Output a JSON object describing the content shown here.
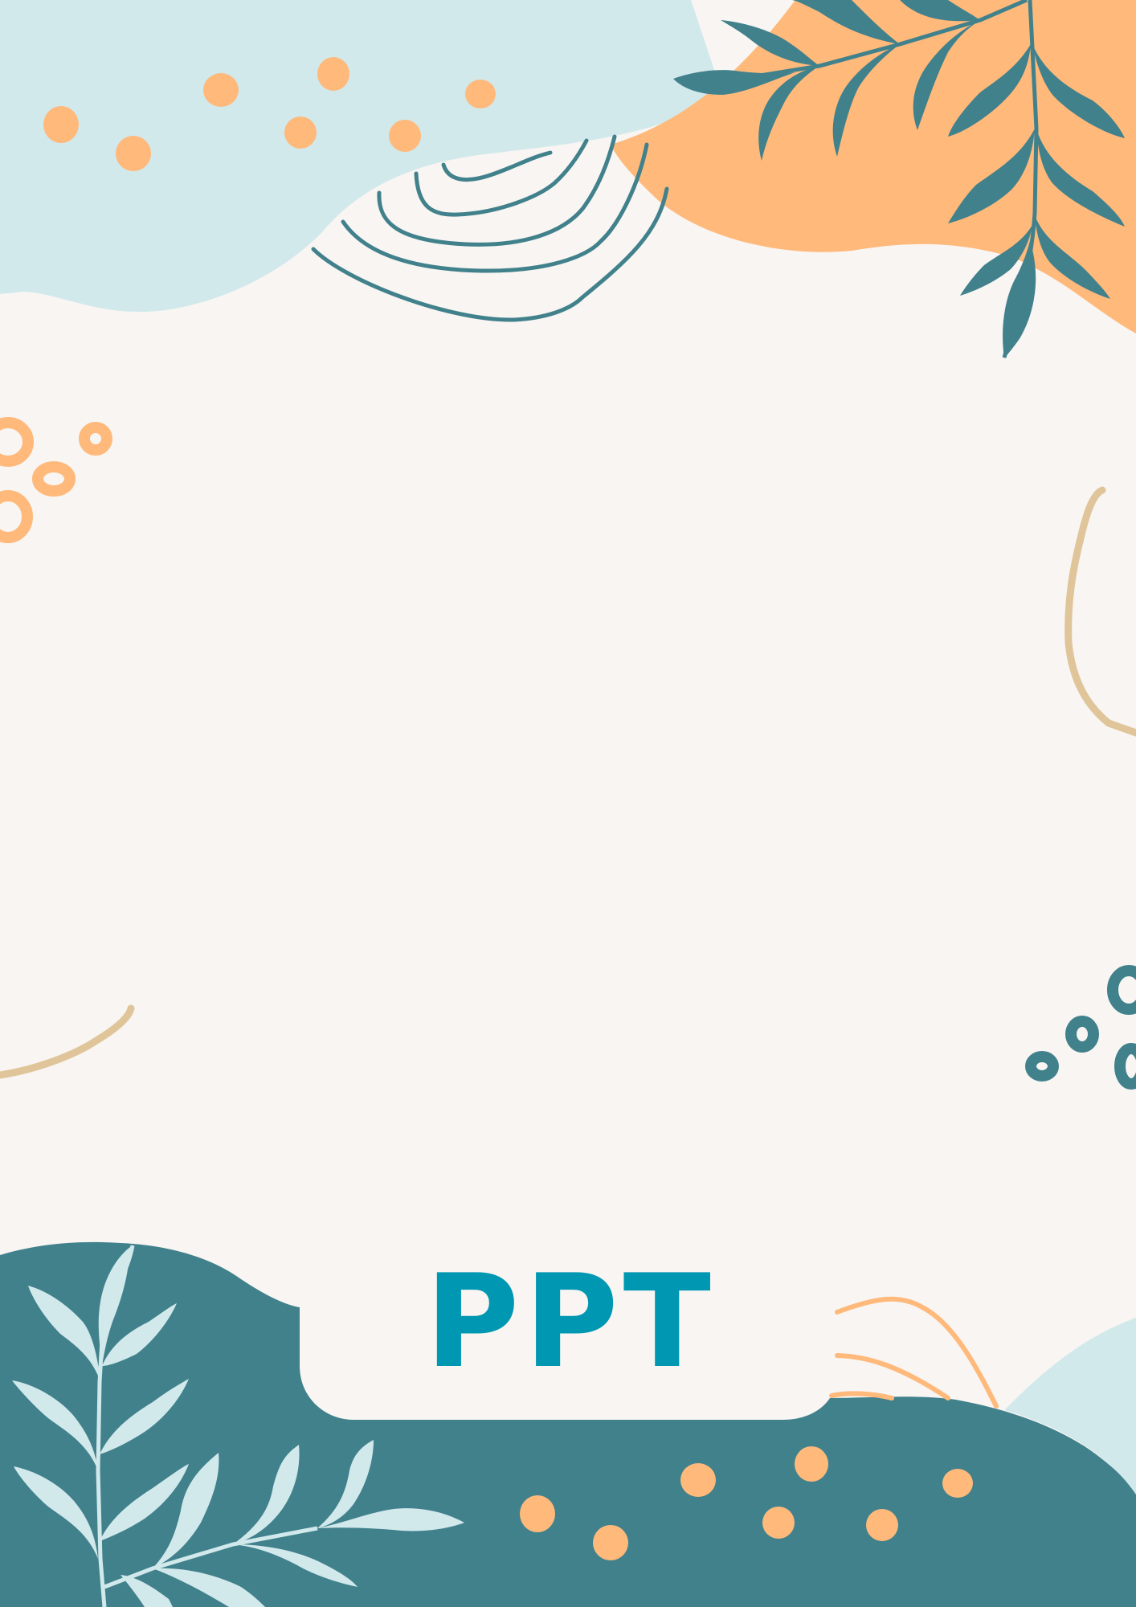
{
  "page": {
    "background_color": "#f8f5f2"
  },
  "colors": {
    "light_blue": "#d2e9ec",
    "peach": "#ffb97b",
    "teal": "#41818c",
    "logo_blue": "#0097b2",
    "sand": "#e0c59a"
  },
  "logo": {
    "text": "PPT"
  },
  "decorations": [
    "light-blue-blob-top-left",
    "peach-blob-top-right",
    "teal-leaf-branch-top-right",
    "contour-lines-top",
    "peach-dots-top",
    "peach-ring-dots-left",
    "sand-curve-right",
    "sand-curve-left",
    "teal-ring-dots-right",
    "teal-band-bottom",
    "light-blue-leaf-branch-bottom-left",
    "peach-dots-bottom",
    "peach-lines-bottom-right",
    "light-blue-blob-bottom-right"
  ]
}
